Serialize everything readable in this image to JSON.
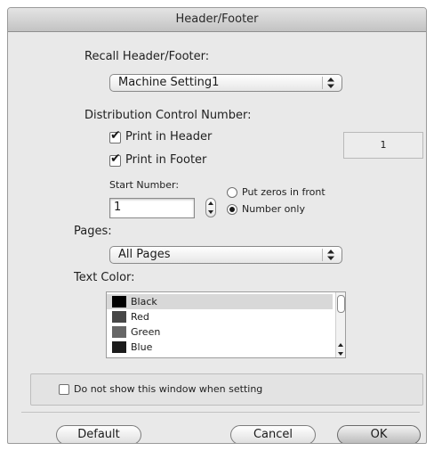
{
  "window": {
    "title": "Header/Footer"
  },
  "recall": {
    "label": "Recall Header/Footer:",
    "selected": "Machine Setting1"
  },
  "distribution": {
    "label": "Distribution Control Number:",
    "print_header": {
      "label": "Print in Header",
      "checked": true
    },
    "print_footer": {
      "label": "Print in Footer",
      "checked": true
    },
    "counter_value": "1",
    "start_number": {
      "label": "Start Number:",
      "value": "1"
    },
    "zero_options": [
      {
        "label": "Put zeros in front",
        "selected": false
      },
      {
        "label": "Number only",
        "selected": true
      }
    ]
  },
  "pages": {
    "label": "Pages:",
    "selected": "All Pages"
  },
  "text_color": {
    "label": "Text Color:",
    "items": [
      {
        "name": "Black",
        "swatch": "#000000",
        "selected": true
      },
      {
        "name": "Red",
        "swatch": "#474747",
        "selected": false
      },
      {
        "name": "Green",
        "swatch": "#666666",
        "selected": false
      },
      {
        "name": "Blue",
        "swatch": "#1c1c1c",
        "selected": false
      }
    ]
  },
  "do_not_show": {
    "label": "Do not show this window when setting",
    "checked": false
  },
  "buttons": {
    "default": "Default",
    "cancel": "Cancel",
    "ok": "OK"
  }
}
